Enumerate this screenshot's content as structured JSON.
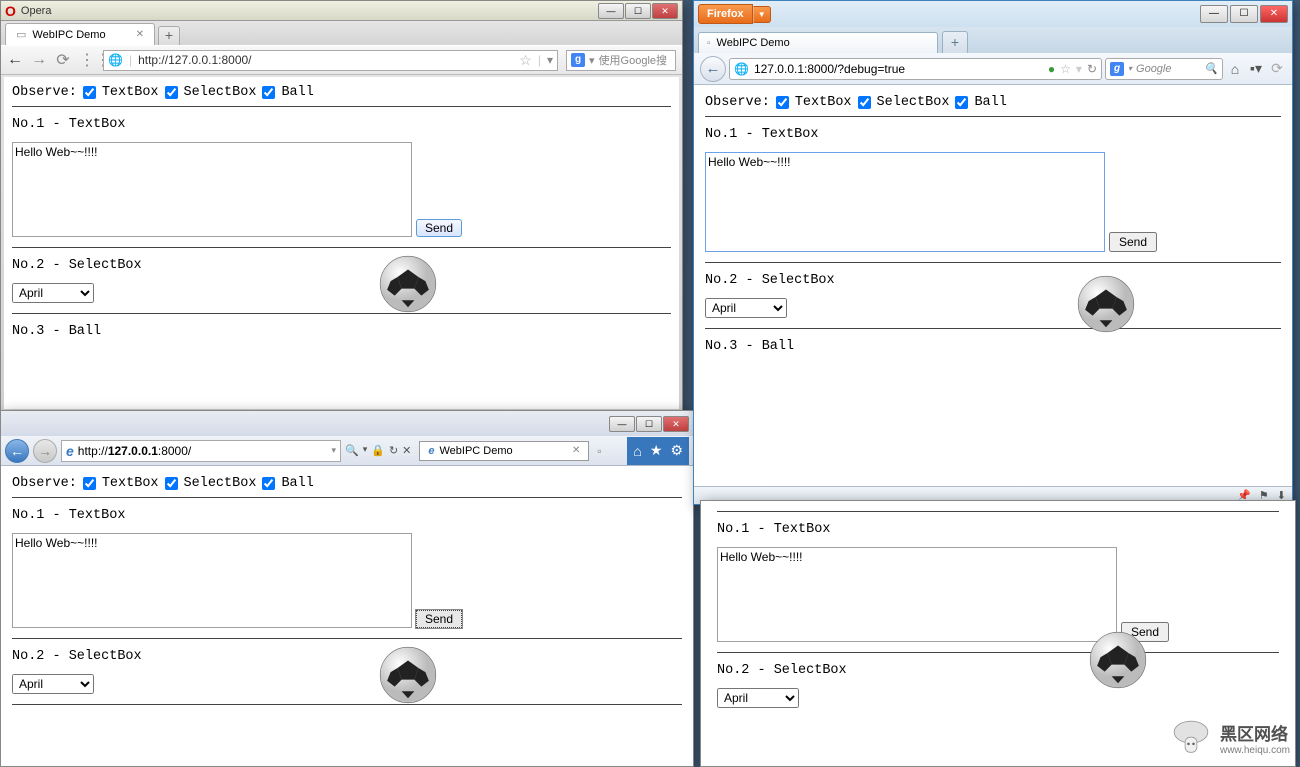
{
  "opera": {
    "title": "Opera",
    "tab_title": "WebIPC Demo",
    "url": "http://127.0.0.1:8000/",
    "search_placeholder": "使用Google搜",
    "content": {
      "observe_label": "Observe:",
      "chk_textbox": "TextBox",
      "chk_selectbox": "SelectBox",
      "chk_ball": "Ball",
      "section1": "No.1 - TextBox",
      "textbox_value": "Hello Web~~!!!!",
      "send_label": "Send",
      "section2": "No.2 - SelectBox",
      "select_value": "April",
      "section3": "No.3 - Ball"
    }
  },
  "ie": {
    "url_host": "127.0.0.1",
    "url_port": ":8000/",
    "url_prefix": "http://",
    "tab_title": "WebIPC Demo",
    "content": {
      "observe_label": "Observe:",
      "chk_textbox": "TextBox",
      "chk_selectbox": "SelectBox",
      "chk_ball": "Ball",
      "section1": "No.1 - TextBox",
      "textbox_value": "Hello Web~~!!!!",
      "send_label": "Send",
      "section2": "No.2 - SelectBox",
      "select_value": "April"
    }
  },
  "firefox": {
    "btn_label": "Firefox",
    "tab_title": "WebIPC Demo",
    "url": "127.0.0.1:8000/?debug=true",
    "search_placeholder": "Google",
    "content": {
      "observe_label": "Observe:",
      "chk_textbox": "TextBox",
      "chk_selectbox": "SelectBox",
      "chk_ball": "Ball",
      "section1": "No.1 - TextBox",
      "textbox_value": "Hello Web~~!!!!",
      "send_label": "Send",
      "section2": "No.2 - SelectBox",
      "select_value": "April",
      "section3": "No.3 - Ball"
    }
  },
  "ie2": {
    "content": {
      "section1": "No.1 - TextBox",
      "textbox_value": "Hello Web~~!!!!",
      "send_label": "Send",
      "section2": "No.2 - SelectBox",
      "select_value": "April"
    }
  },
  "watermark": {
    "cn": "黑区网络",
    "url": "www.heiqu.com"
  }
}
